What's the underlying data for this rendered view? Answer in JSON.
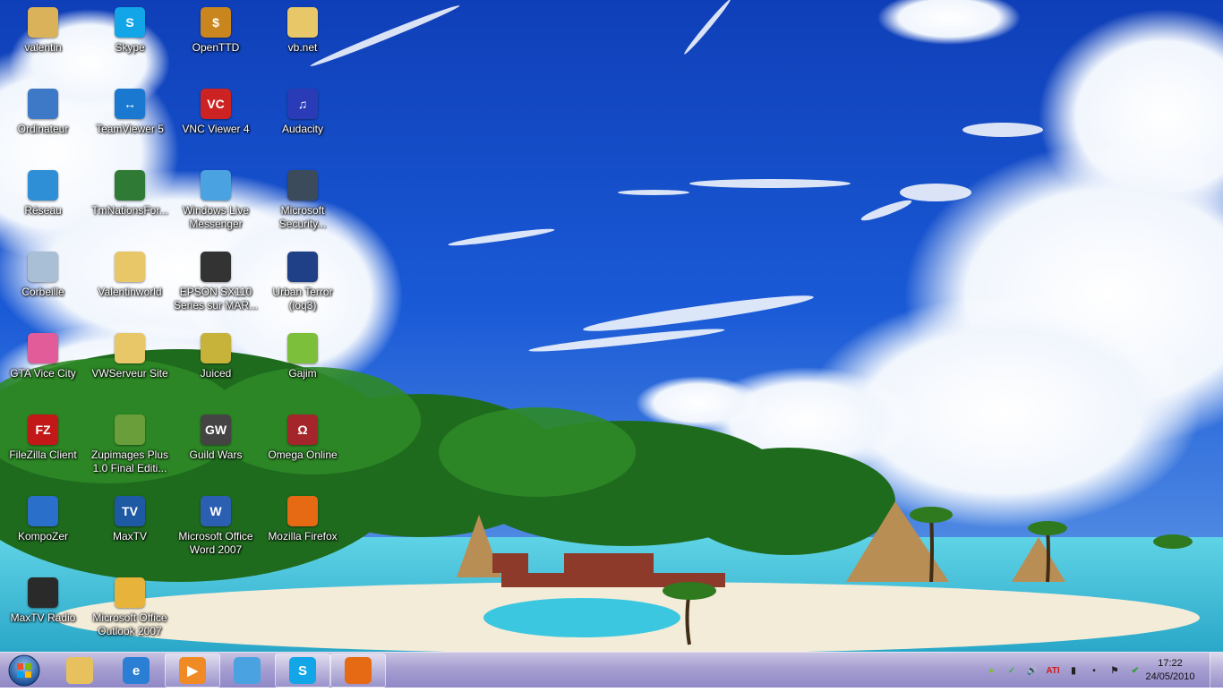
{
  "colors": {
    "sky": "#1a4fc4",
    "taskbar": "#a79fd1",
    "label_text": "#ffffff"
  },
  "desktop": {
    "icons": [
      {
        "label": "valentin",
        "icon": "user-folder-icon",
        "color": "#d9b25a",
        "mark": ""
      },
      {
        "label": "Skype",
        "icon": "skype-icon",
        "color": "#12a5e8",
        "mark": "S"
      },
      {
        "label": "OpenTTD",
        "icon": "openttd-icon",
        "color": "#c9861f",
        "mark": "$"
      },
      {
        "label": "vb.net",
        "icon": "folder-icon",
        "color": "#e8c769",
        "mark": ""
      },
      {
        "label": "Ordinateur",
        "icon": "computer-icon",
        "color": "#3d79c7",
        "mark": ""
      },
      {
        "label": "TeamViewer 5",
        "icon": "teamviewer-icon",
        "color": "#1a78d0",
        "mark": "↔"
      },
      {
        "label": "VNC Viewer 4",
        "icon": "vnc-icon",
        "color": "#cc2222",
        "mark": "VC"
      },
      {
        "label": "Audacity",
        "icon": "audacity-icon",
        "color": "#2a3bb8",
        "mark": "♫"
      },
      {
        "label": "Réseau",
        "icon": "network-icon",
        "color": "#2e8fd6",
        "mark": ""
      },
      {
        "label": "TmNationsFor...",
        "icon": "tmnations-icon",
        "color": "#2f7a34",
        "mark": ""
      },
      {
        "label": "Windows Live Messenger",
        "icon": "messenger-icon",
        "color": "#4aa2e0",
        "mark": ""
      },
      {
        "label": "Microsoft Security...",
        "icon": "security-essentials-icon",
        "color": "#3b4b5c",
        "mark": ""
      },
      {
        "label": "Corbeille",
        "icon": "recycle-bin-icon",
        "color": "#a9bfd6",
        "mark": ""
      },
      {
        "label": "Valentinworld",
        "icon": "folder-icon",
        "color": "#e8c769",
        "mark": ""
      },
      {
        "label": "EPSON SX110 Series sur MAR...",
        "icon": "printer-icon",
        "color": "#333333",
        "mark": ""
      },
      {
        "label": "Urban Terror (ioq3)",
        "icon": "urban-terror-icon",
        "color": "#1f3f86",
        "mark": ""
      },
      {
        "label": "GTA Vice City",
        "icon": "gta-vice-city-icon",
        "color": "#e25c9a",
        "mark": ""
      },
      {
        "label": "VWServeur Site",
        "icon": "folder-icon",
        "color": "#e8c769",
        "mark": ""
      },
      {
        "label": "Juiced",
        "icon": "juiced-icon",
        "color": "#c7b23a",
        "mark": ""
      },
      {
        "label": "Gajim",
        "icon": "gajim-icon",
        "color": "#7bbf3a",
        "mark": ""
      },
      {
        "label": "FileZilla Client",
        "icon": "filezilla-icon",
        "color": "#c31818",
        "mark": "FZ"
      },
      {
        "label": "Zupimages Plus 1.0 Final Editi...",
        "icon": "zupimages-icon",
        "color": "#6a9e3a",
        "mark": ""
      },
      {
        "label": "Guild Wars",
        "icon": "guild-wars-icon",
        "color": "#444444",
        "mark": "GW"
      },
      {
        "label": "Omega Online",
        "icon": "omega-online-icon",
        "color": "#a5262a",
        "mark": "Ω"
      },
      {
        "label": "KompoZer",
        "icon": "kompozer-icon",
        "color": "#2a6fc9",
        "mark": ""
      },
      {
        "label": "MaxTV",
        "icon": "maxtv-icon",
        "color": "#1d5aa3",
        "mark": "TV"
      },
      {
        "label": "Microsoft Office Word 2007",
        "icon": "word-icon",
        "color": "#2b5fb2",
        "mark": "W"
      },
      {
        "label": "Mozilla Firefox",
        "icon": "firefox-icon",
        "color": "#e66a13",
        "mark": ""
      },
      {
        "label": "MaxTV Radio",
        "icon": "maxtv-radio-icon",
        "color": "#2a2a2a",
        "mark": ""
      },
      {
        "label": "Microsoft Office Outlook 2007",
        "icon": "outlook-icon",
        "color": "#e8b33a",
        "mark": ""
      }
    ]
  },
  "taskbar": {
    "start_icon": "windows-start-orb-icon",
    "pinned": [
      {
        "icon": "windows-explorer-icon",
        "color": "#e6c15e",
        "mark": ""
      },
      {
        "icon": "internet-explorer-icon",
        "color": "#2a7fd4",
        "mark": "e"
      },
      {
        "icon": "media-player-icon",
        "color": "#f08a24",
        "mark": "▶"
      },
      {
        "icon": "messenger-icon",
        "color": "#4aa2e0",
        "mark": ""
      },
      {
        "icon": "skype-icon",
        "color": "#12a5e8",
        "mark": "S"
      },
      {
        "icon": "firefox-icon",
        "color": "#e66a13",
        "mark": ""
      }
    ],
    "tray": [
      {
        "icon": "gajim-tray-icon",
        "color": "#7bbf3a",
        "mark": "●"
      },
      {
        "icon": "security-check-icon",
        "color": "#3bb54a",
        "mark": "✓"
      },
      {
        "icon": "volume-icon",
        "color": "#222222",
        "mark": "🔊"
      },
      {
        "icon": "ati-icon",
        "color": "#d11a1a",
        "mark": "ATI"
      },
      {
        "icon": "network-signal-icon",
        "color": "#222222",
        "mark": "▮"
      },
      {
        "icon": "usb-device-icon",
        "color": "#222222",
        "mark": "▪"
      },
      {
        "icon": "action-center-flag-icon",
        "color": "#222222",
        "mark": "⚑"
      },
      {
        "icon": "update-check-icon",
        "color": "#2f9e3a",
        "mark": "✔"
      }
    ],
    "clock": {
      "time": "17:22",
      "date": "24/05/2010"
    }
  }
}
